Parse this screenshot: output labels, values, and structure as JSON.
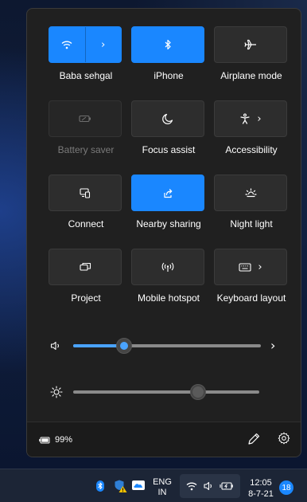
{
  "quick_settings": {
    "tiles": [
      {
        "label": "Baba sehgal",
        "icon": "wifi-icon",
        "state": "on",
        "has_chevron": true,
        "split": true
      },
      {
        "label": "iPhone",
        "icon": "bluetooth-icon",
        "state": "on"
      },
      {
        "label": "Airplane mode",
        "icon": "airplane-icon",
        "state": "off"
      },
      {
        "label": "Battery saver",
        "icon": "battery-saver-icon",
        "state": "disabled"
      },
      {
        "label": "Focus assist",
        "icon": "moon-icon",
        "state": "off"
      },
      {
        "label": "Accessibility",
        "icon": "accessibility-icon",
        "state": "off",
        "has_chevron": true
      },
      {
        "label": "Connect",
        "icon": "cast-icon",
        "state": "off"
      },
      {
        "label": "Nearby sharing",
        "icon": "share-icon",
        "state": "on"
      },
      {
        "label": "Night light",
        "icon": "night-light-icon",
        "state": "off"
      },
      {
        "label": "Project",
        "icon": "project-icon",
        "state": "off"
      },
      {
        "label": "Mobile hotspot",
        "icon": "hotspot-icon",
        "state": "off"
      },
      {
        "label": "Keyboard layout",
        "icon": "keyboard-icon",
        "state": "off",
        "has_chevron": true
      }
    ],
    "volume": {
      "level": 0.27,
      "icon": "speaker-icon"
    },
    "brightness": {
      "level": 0.67,
      "icon": "sun-icon"
    },
    "battery": {
      "percent": "99%",
      "icon": "battery-icon"
    },
    "footer_buttons": [
      "edit-icon",
      "settings-gear-icon"
    ]
  },
  "taskbar": {
    "language_top": "ENG",
    "language_bottom": "IN",
    "time": "12:05",
    "date": "8-7-21",
    "notification_count": "18"
  },
  "colors": {
    "accent": "#1a87ff",
    "panel_bg": "#202020",
    "tile_off": "#2d2d2d"
  }
}
